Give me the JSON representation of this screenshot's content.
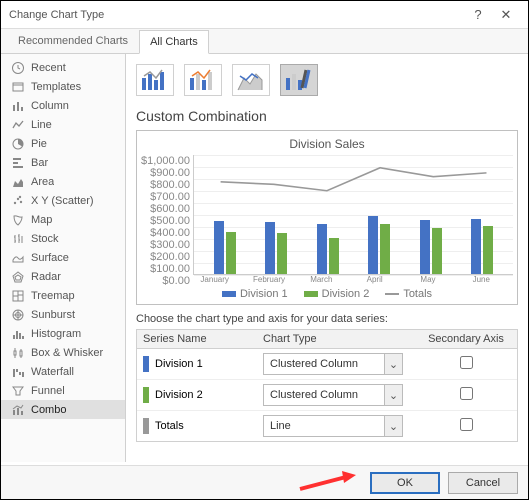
{
  "window": {
    "title": "Change Chart Type",
    "help": "?",
    "close": "✕"
  },
  "tabs": {
    "recommended": "Recommended Charts",
    "all": "All Charts"
  },
  "sidebar": {
    "items": [
      {
        "id": "recent",
        "label": "Recent"
      },
      {
        "id": "templates",
        "label": "Templates"
      },
      {
        "id": "column",
        "label": "Column"
      },
      {
        "id": "line",
        "label": "Line"
      },
      {
        "id": "pie",
        "label": "Pie"
      },
      {
        "id": "bar",
        "label": "Bar"
      },
      {
        "id": "area",
        "label": "Area"
      },
      {
        "id": "scatter",
        "label": "X Y (Scatter)"
      },
      {
        "id": "map",
        "label": "Map"
      },
      {
        "id": "stock",
        "label": "Stock"
      },
      {
        "id": "surface",
        "label": "Surface"
      },
      {
        "id": "radar",
        "label": "Radar"
      },
      {
        "id": "treemap",
        "label": "Treemap"
      },
      {
        "id": "sunburst",
        "label": "Sunburst"
      },
      {
        "id": "histogram",
        "label": "Histogram"
      },
      {
        "id": "boxwhisker",
        "label": "Box & Whisker"
      },
      {
        "id": "waterfall",
        "label": "Waterfall"
      },
      {
        "id": "funnel",
        "label": "Funnel"
      },
      {
        "id": "combo",
        "label": "Combo"
      }
    ]
  },
  "section_title": "Custom Combination",
  "chart_data": {
    "type": "bar+line",
    "title": "Division Sales",
    "categories": [
      "January",
      "February",
      "March",
      "April",
      "May",
      "June"
    ],
    "y_ticks": [
      "$1,000.00",
      "$900.00",
      "$800.00",
      "$700.00",
      "$600.00",
      "$500.00",
      "$400.00",
      "$300.00",
      "$200.00",
      "$100.00",
      "$0.00"
    ],
    "ylim": [
      0,
      1000
    ],
    "series": [
      {
        "name": "Division 1",
        "values": [
          440,
          430,
          420,
          480,
          450,
          460
        ],
        "color": "#4472c4",
        "kind": "bar"
      },
      {
        "name": "Division 2",
        "values": [
          350,
          340,
          300,
          420,
          380,
          400
        ],
        "color": "#70ad47",
        "kind": "bar"
      },
      {
        "name": "Totals",
        "values": [
          790,
          770,
          720,
          900,
          830,
          860
        ],
        "color": "#999999",
        "kind": "line"
      }
    ],
    "legend": [
      "Division 1",
      "Division 2",
      "Totals"
    ]
  },
  "series_section": {
    "prompt": "Choose the chart type and axis for your data series:",
    "headers": {
      "name": "Series Name",
      "type": "Chart Type",
      "axis": "Secondary Axis"
    },
    "rows": [
      {
        "name": "Division 1",
        "swatch": "d1",
        "type": "Clustered Column",
        "secondary": false
      },
      {
        "name": "Division 2",
        "swatch": "d2",
        "type": "Clustered Column",
        "secondary": false
      },
      {
        "name": "Totals",
        "swatch": "tot",
        "type": "Line",
        "secondary": false
      }
    ]
  },
  "footer": {
    "ok": "OK",
    "cancel": "Cancel"
  }
}
